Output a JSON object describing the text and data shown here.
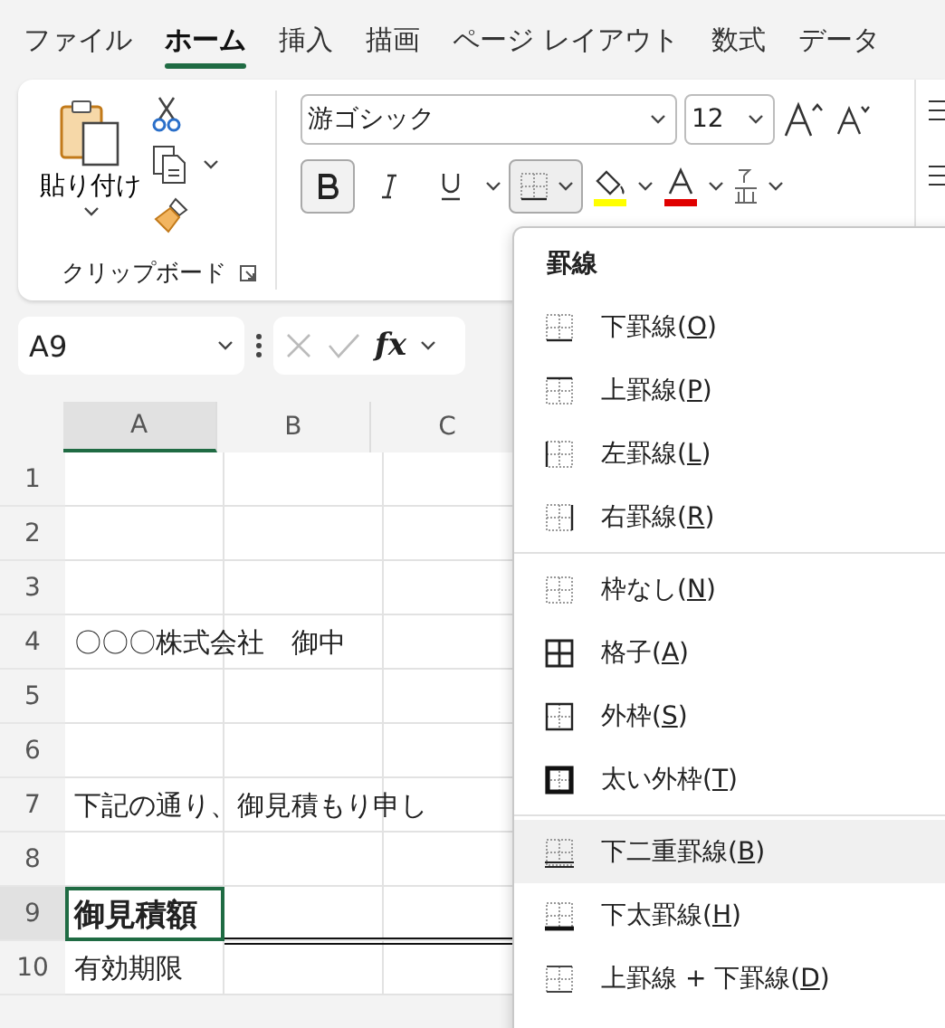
{
  "tabs": [
    {
      "label": "ファイル",
      "selected": false
    },
    {
      "label": "ホーム",
      "selected": true
    },
    {
      "label": "挿入",
      "selected": false
    },
    {
      "label": "描画",
      "selected": false
    },
    {
      "label": "ページ レイアウト",
      "selected": false
    },
    {
      "label": "数式",
      "selected": false
    },
    {
      "label": "データ",
      "selected": false
    }
  ],
  "clipboard": {
    "paste_label": "貼り付け",
    "group_label": "クリップボード"
  },
  "font": {
    "name": "游ゴシック",
    "size": "12",
    "bold_active": true,
    "borders_open": true
  },
  "name_box": "A9",
  "formula_icon": "fx",
  "columns": [
    {
      "label": "A",
      "selected": true
    },
    {
      "label": "B",
      "selected": false
    },
    {
      "label": "C",
      "selected": false
    }
  ],
  "rows": [
    {
      "number": "1",
      "selected": false
    },
    {
      "number": "2",
      "selected": false
    },
    {
      "number": "3",
      "selected": false
    },
    {
      "number": "4",
      "text": "〇〇〇株式会社　御中",
      "selected": false
    },
    {
      "number": "5",
      "selected": false
    },
    {
      "number": "6",
      "selected": false
    },
    {
      "number": "7",
      "text": "下記の通り、御見積もり申し",
      "selected": false
    },
    {
      "number": "8",
      "selected": false
    },
    {
      "number": "9",
      "text": "御見積額",
      "bold": true,
      "selected": true
    },
    {
      "number": "10",
      "text": "有効期限",
      "selected": false
    }
  ],
  "border_menu": {
    "title": "罫線",
    "sections": [
      {
        "items": [
          {
            "kind": "bottom",
            "before": "下罫線(",
            "key": "O",
            "after": ")",
            "selected": false
          },
          {
            "kind": "top",
            "before": "上罫線(",
            "key": "P",
            "after": ")",
            "selected": false
          },
          {
            "kind": "left",
            "before": "左罫線(",
            "key": "L",
            "after": ")",
            "selected": false
          },
          {
            "kind": "right",
            "before": "右罫線(",
            "key": "R",
            "after": ")",
            "selected": false
          }
        ]
      },
      {
        "items": [
          {
            "kind": "none",
            "before": "枠なし(",
            "key": "N",
            "after": ")",
            "selected": false
          },
          {
            "kind": "all",
            "before": "格子(",
            "key": "A",
            "after": ")",
            "selected": false
          },
          {
            "kind": "outside",
            "before": "外枠(",
            "key": "S",
            "after": ")",
            "selected": false
          },
          {
            "kind": "thick-outside",
            "before": "太い外枠(",
            "key": "T",
            "after": ")",
            "selected": false
          }
        ]
      },
      {
        "items": [
          {
            "kind": "double-bottom",
            "before": "下二重罫線(",
            "key": "B",
            "after": ")",
            "selected": true
          },
          {
            "kind": "thick-bottom",
            "before": "下太罫線(",
            "key": "H",
            "after": ")",
            "selected": false
          },
          {
            "kind": "top-bottom",
            "before": "上罫線 + 下罫線(",
            "key": "D",
            "after": ")",
            "selected": false
          }
        ]
      }
    ]
  }
}
